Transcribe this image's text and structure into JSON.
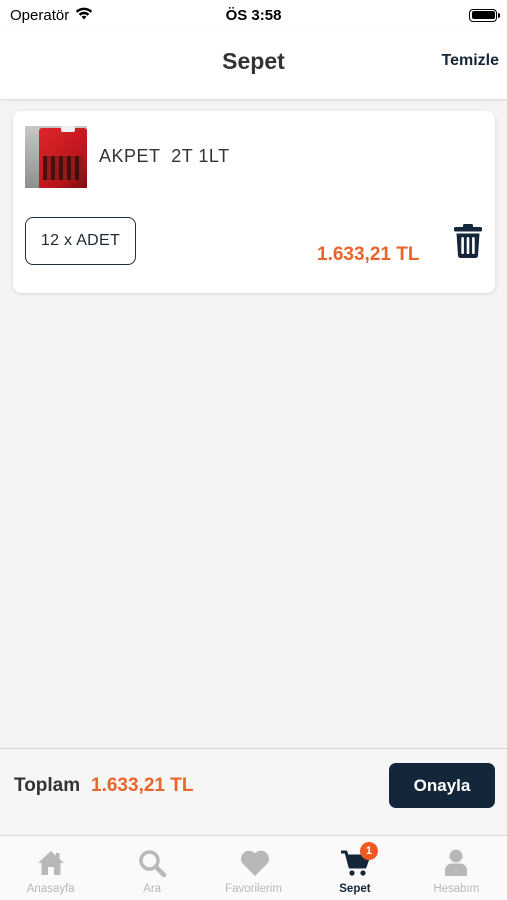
{
  "status_bar": {
    "carrier": "Operatör",
    "time": "ÖS 3:58"
  },
  "header": {
    "title": "Sepet",
    "clear_label": "Temizle"
  },
  "cart": {
    "items": [
      {
        "name": "AKPET  2T 1LT",
        "quantity_label": "12 x ADET",
        "price": "1.633,21 TL",
        "image_icon": "oil-can-image"
      }
    ]
  },
  "summary": {
    "total_label": "Toplam",
    "total_value": "1.633,21 TL",
    "confirm_label": "Onayla"
  },
  "tabs": [
    {
      "label": "Anasayfa",
      "icon": "home-icon",
      "active": false
    },
    {
      "label": "Ara",
      "icon": "search-icon",
      "active": false
    },
    {
      "label": "Favorilerim",
      "icon": "heart-icon",
      "active": false
    },
    {
      "label": "Sepet",
      "icon": "cart-icon",
      "active": true,
      "badge": "1"
    },
    {
      "label": "Hesabım",
      "icon": "user-icon",
      "active": false
    }
  ],
  "colors": {
    "accent": "#e8652a",
    "primary": "#14273a",
    "badge": "#ee5a22",
    "inactive_tab": "#b8b8b8"
  }
}
